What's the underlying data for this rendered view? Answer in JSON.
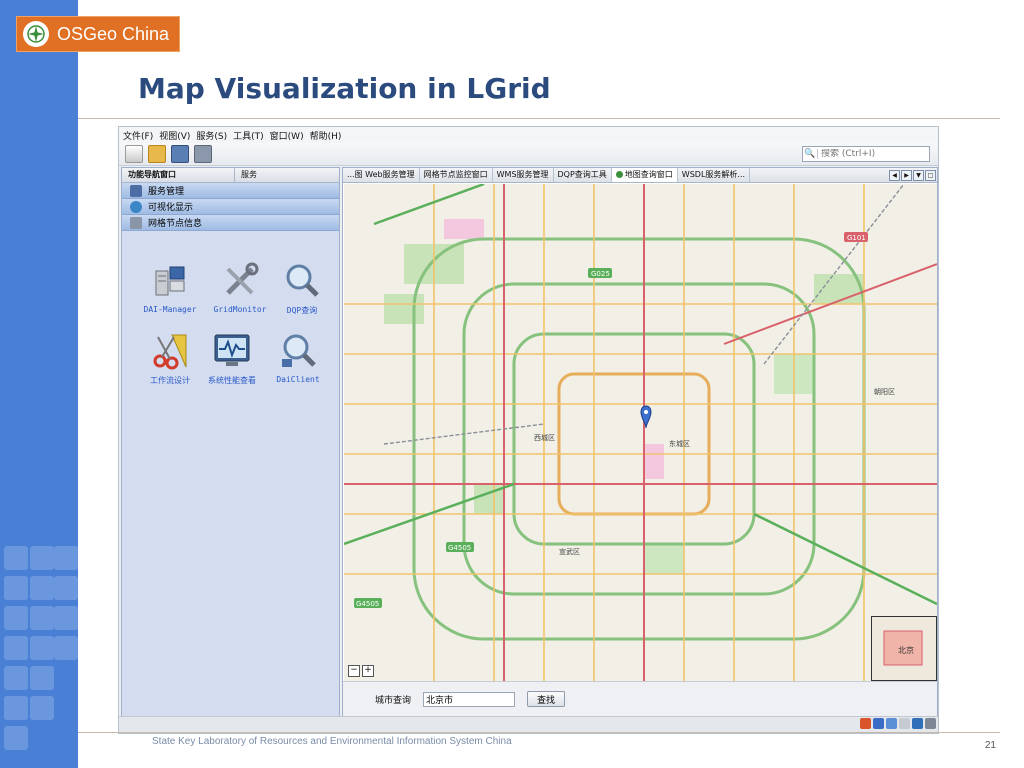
{
  "slide": {
    "logo_text": "OSGeo China",
    "title": "Map Visualization in LGrid",
    "footer": "State Key Laboratory of Resources and Environmental Information System China",
    "page_number": "21"
  },
  "menu": [
    "文件(F)",
    "视图(V)",
    "服务(S)",
    "工具(T)",
    "窗口(W)",
    "帮助(H)"
  ],
  "search": {
    "placeholder": "搜索 (Ctrl+I)"
  },
  "nav": {
    "tab_label": "功能导航窗口",
    "tab2_label": "服务",
    "sections": [
      "服务管理",
      "可视化显示",
      "网格节点信息"
    ],
    "tools": [
      {
        "label": "DAI-Manager",
        "icon": "server-icon"
      },
      {
        "label": "GridMonitor",
        "icon": "tools-icon"
      },
      {
        "label": "DQP查询",
        "icon": "magnifier-icon"
      },
      {
        "label": "工作流设计",
        "icon": "scissors-ruler-icon"
      },
      {
        "label": "系统性能查看",
        "icon": "monitor-chart-icon"
      },
      {
        "label": "DaiClient",
        "icon": "magnifier-client-icon"
      }
    ]
  },
  "map_tabs": [
    {
      "label": "...图 Web服务管理"
    },
    {
      "label": "网格节点监控窗口"
    },
    {
      "label": "WMS服务管理"
    },
    {
      "label": "DQP查询工具"
    },
    {
      "label": "地图查询窗口",
      "active": true
    },
    {
      "label": "WSDL服务解析..."
    }
  ],
  "map": {
    "district_labels": [
      "西城区",
      "东城区",
      "宣武区",
      "朝阳区"
    ],
    "road_shields": [
      "G101",
      "G025",
      "G4505",
      "G4505"
    ],
    "minimap_label": "北京"
  },
  "city_search": {
    "label": "城市查询",
    "value": "北京市",
    "button": "查找"
  },
  "colors": {
    "accent": "#4a7fd6",
    "title": "#2b4b7e",
    "logo": "#e07023"
  }
}
